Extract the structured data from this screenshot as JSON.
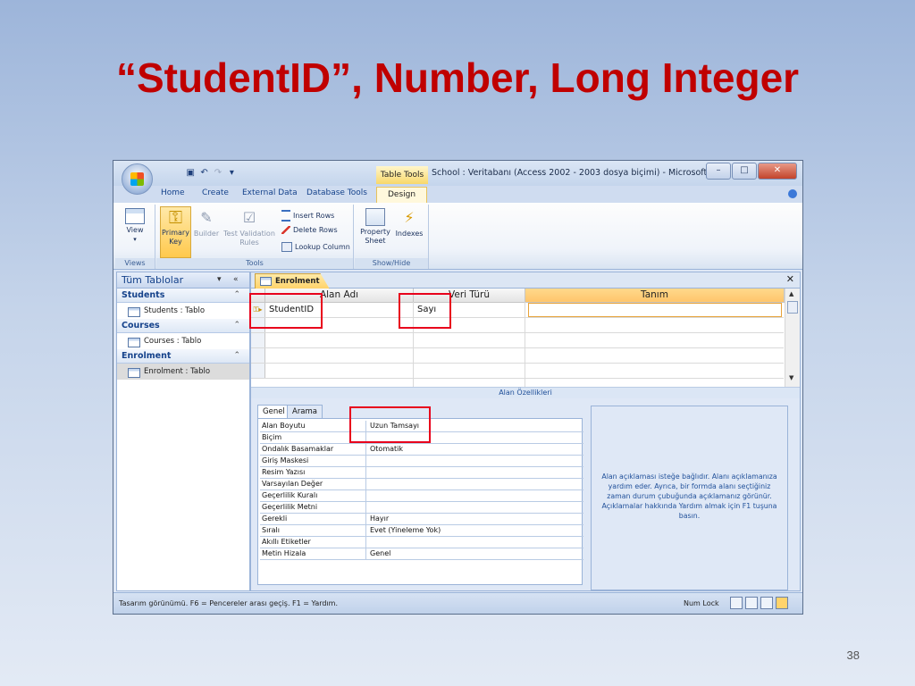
{
  "slide": {
    "title": "“StudentID”, Number, Long Integer",
    "page_number": "38"
  },
  "window": {
    "title": "School : Veritabanı (Access 2002 - 2003 dosya biçimi) - Microsoft ...",
    "context_tab_label": "Table Tools",
    "controls": {
      "minimize": "–",
      "maximize": "□",
      "close": "✕"
    }
  },
  "ribbon_tabs": [
    "Home",
    "Create",
    "External Data",
    "Database Tools",
    "Design"
  ],
  "ribbon": {
    "views_group": {
      "label": "Views",
      "view_button": "View"
    },
    "tools_group": {
      "label": "Tools",
      "primary_key": "Primary Key",
      "builder": "Builder",
      "test_validation_rules": "Test Validation Rules",
      "insert_rows": "Insert Rows",
      "delete_rows": "Delete Rows",
      "lookup_column": "Lookup Column"
    },
    "showhide_group": {
      "label": "Show/Hide",
      "property_sheet": "Property Sheet",
      "indexes": "Indexes"
    }
  },
  "nav": {
    "header": "Tüm Tablolar",
    "groups": [
      {
        "label": "Students",
        "item": "Students : Tablo"
      },
      {
        "label": "Courses",
        "item": "Courses : Tablo"
      },
      {
        "label": "Enrolment",
        "item": "Enrolment : Tablo"
      }
    ]
  },
  "document": {
    "tab_label": "Enrolment",
    "columns": {
      "field_name": "Alan Adı",
      "data_type": "Veri Türü",
      "description": "Tanım"
    },
    "row1": {
      "field_name": "StudentID",
      "data_type": "Sayı",
      "description": ""
    },
    "field_properties_label": "Alan Özellikleri"
  },
  "properties": {
    "tabs": [
      "Genel",
      "Arama"
    ],
    "rows": [
      {
        "key": "Alan Boyutu",
        "value": "Uzun Tamsayı"
      },
      {
        "key": "Biçim",
        "value": ""
      },
      {
        "key": "Ondalık Basamaklar",
        "value": "Otomatik"
      },
      {
        "key": "Giriş Maskesi",
        "value": ""
      },
      {
        "key": "Resim Yazısı",
        "value": ""
      },
      {
        "key": "Varsayılan Değer",
        "value": ""
      },
      {
        "key": "Geçerlilik Kuralı",
        "value": ""
      },
      {
        "key": "Geçerlilik Metni",
        "value": ""
      },
      {
        "key": "Gerekli",
        "value": "Hayır"
      },
      {
        "key": "Sıralı",
        "value": "Evet (Yineleme Yok)"
      },
      {
        "key": "Akıllı Etiketler",
        "value": ""
      },
      {
        "key": "Metin Hizala",
        "value": "Genel"
      }
    ],
    "help_text": "Alan açıklaması isteğe bağlıdır. Alanı açıklamanıza yardım eder. Ayrıca, bir formda alanı seçtiğiniz zaman durum çubuğunda açıklamanız görünür. Açıklamalar hakkında Yardım almak için F1 tuşuna basın."
  },
  "statusbar": {
    "left": "Tasarım görünümü.  F6 = Pencereler arası geçiş.  F1 = Yardım.",
    "numlock": "Num Lock"
  },
  "colors": {
    "title_red": "#c00000",
    "highlight_red": "#e8001c",
    "accent_orange": "#ffc56b"
  }
}
